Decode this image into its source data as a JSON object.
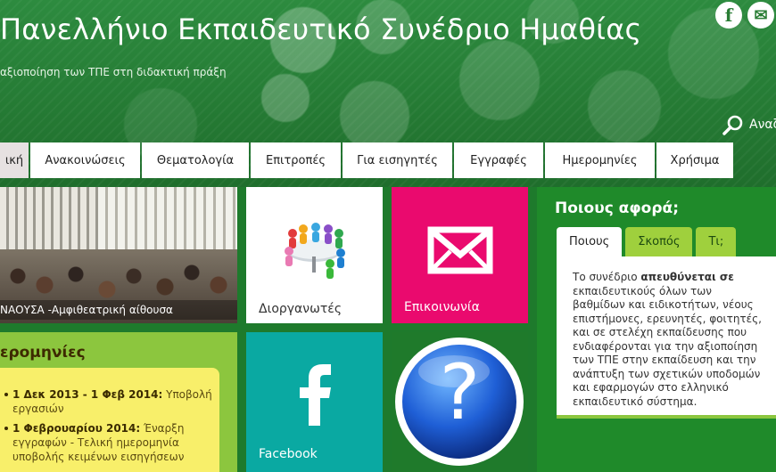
{
  "header": {
    "title": "Πανελλήνιο Εκπαιδευτικό Συνέδριο Ημαθίας",
    "subtitle": "αξιοποίηση των ΤΠΕ στη διδακτική πράξη",
    "search_label": "Αναζ",
    "social": [
      {
        "name": "facebook",
        "glyph": "f"
      },
      {
        "name": "email",
        "glyph": "✉"
      }
    ]
  },
  "nav": {
    "items": [
      {
        "label": "ική",
        "width": 32,
        "active": true
      },
      {
        "label": "Ανακοινώσεις",
        "width": 123
      },
      {
        "label": "Θεματολογία",
        "width": 120
      },
      {
        "label": "Επιτροπές",
        "width": 101
      },
      {
        "label": "Για εισηγητές",
        "width": 123
      },
      {
        "label": "Εγγραφές",
        "width": 100
      },
      {
        "label": "Ημερομηνίες",
        "width": 123
      },
      {
        "label": "Χρήσιμα",
        "width": 86
      }
    ]
  },
  "tiles": {
    "photo_caption": "ΝΑΟΥΣΑ -Αμφιθεατρική αίθουσα",
    "organizers_label": "Διοργανωτές",
    "contact_label": "Επικοινωνία",
    "facebook_label": "Facebook",
    "help_glyph": "?"
  },
  "dates": {
    "heading": "ερομηνίες",
    "items": [
      {
        "bold": "1 Δεκ 2013  - 1 Φεβ 2014:",
        "text": " Υποβολή εργασιών"
      },
      {
        "bold": "1 Φεβρουαρίου 2014:",
        "text": " Έναρξη εγγραφών - Τελική ημερομηνία υποβολής κειμένων εισηγήσεων"
      }
    ]
  },
  "who": {
    "heading": "Ποιους αφορά;",
    "tabs": [
      {
        "label": "Ποιους",
        "active": true
      },
      {
        "label": "Σκοπός"
      },
      {
        "label": "Τι;"
      }
    ],
    "content_before": "Το συνέδριο ",
    "content_bold": "απευθύνεται σε",
    "content_after": " εκπαιδευτικούς όλων των βαθμίδων και ειδικοτήτων, νέους επιστήμονες, ερευνητές, φοιτητές, και σε στελέχη εκπαίδευσης που ενδιαφέρονται για την αξιοποίηση των ΤΠΕ στην εκπαίδευση και την ανάπτυξη των σχετικών υποδομών και εφαρμογών στο ελληνικό εκπαιδευτικό σύστημα."
  },
  "colors": {
    "header_green": "#2d8b3f",
    "magenta": "#ea0a6e",
    "teal": "#0aa9a2",
    "lime": "#8cc63e",
    "yellow": "#f8ef6a",
    "dark_green": "#1f8a2a"
  }
}
